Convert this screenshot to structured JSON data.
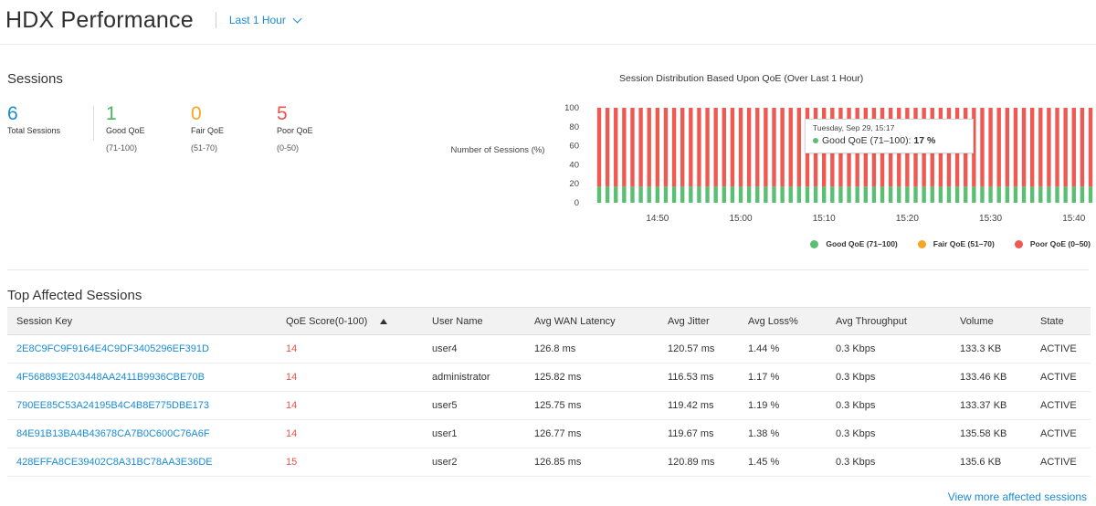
{
  "header": {
    "title": "HDX Performance",
    "time_filter": "Last 1 Hour",
    "time_filter_icon": "chevron-down-icon"
  },
  "sessions": {
    "heading": "Sessions",
    "total": {
      "value": "6",
      "label": "Total Sessions",
      "color": "#1a8bd3"
    },
    "good": {
      "value": "1",
      "label": "Good QoE",
      "range": "(71-100)",
      "color": "#46b75a"
    },
    "fair": {
      "value": "0",
      "label": "Fair QoE",
      "range": "(51-70)",
      "color": "#f5a623"
    },
    "poor": {
      "value": "5",
      "label": "Poor QoE",
      "range": "(0-50)",
      "color": "#e8534a"
    }
  },
  "chart_data": {
    "type": "bar",
    "stacked": true,
    "title": "Session Distribution Based Upon QoE (Over Last 1 Hour)",
    "ylabel": "Number of Sessions (%)",
    "xlabel": "",
    "ylim": [
      0,
      100
    ],
    "yticks": [
      0,
      20,
      40,
      60,
      80,
      100
    ],
    "x_start": "14:43",
    "x_end": "15:42",
    "xticks": [
      "14:50",
      "15:00",
      "15:10",
      "15:20",
      "15:30",
      "15:40"
    ],
    "grid": false,
    "legend_position": "bottom-right",
    "series": [
      {
        "name": "Good QoE (71–100)",
        "color": "#5bbf73",
        "value_each_bar": 17
      },
      {
        "name": "Fair QoE (51–70)",
        "color": "#f5a623",
        "value_each_bar": 0
      },
      {
        "name": "Poor QoE (0–50)",
        "color": "#ee5a52",
        "value_each_bar": 83
      }
    ],
    "tooltip": {
      "date": "Tuesday, Sep 29, 15:17",
      "series": "Good QoE (71–100): ",
      "value": "17 %"
    }
  },
  "table": {
    "heading": "Top Affected Sessions",
    "columns": [
      "Session Key",
      "QoE Score(0-100)",
      "User Name",
      "Avg WAN Latency",
      "Avg Jitter",
      "Avg Loss%",
      "Avg Throughput",
      "Volume",
      "State"
    ],
    "rows": [
      [
        "2E8C9FC9F9164E4C9DF3405296EF391D",
        "14",
        "user4",
        "126.8 ms",
        "120.57 ms",
        "1.44 %",
        "0.3 Kbps",
        "133.3 KB",
        "ACTIVE"
      ],
      [
        "4F568893E203448AA2411B9936CBE70B",
        "14",
        "administrator",
        "125.82 ms",
        "116.53 ms",
        "1.17 %",
        "0.3 Kbps",
        "133.46 KB",
        "ACTIVE"
      ],
      [
        "790EE85C53A24195B4C4B8E775DBE173",
        "14",
        "user5",
        "125.75 ms",
        "119.42 ms",
        "1.19 %",
        "0.3 Kbps",
        "133.37 KB",
        "ACTIVE"
      ],
      [
        "84E91B13BA4B43678CA7B0C600C76A6F",
        "14",
        "user1",
        "126.77 ms",
        "119.67 ms",
        "1.38 %",
        "0.3 Kbps",
        "135.58 KB",
        "ACTIVE"
      ],
      [
        "428EFFA8CE39402C8A31BC78AA3E36DE",
        "15",
        "user2",
        "126.85 ms",
        "120.89 ms",
        "1.45 %",
        "0.3 Kbps",
        "135.6 KB",
        "ACTIVE"
      ]
    ],
    "sort_icon": "sort-ascending-icon",
    "view_more": "View more affected sessions"
  }
}
